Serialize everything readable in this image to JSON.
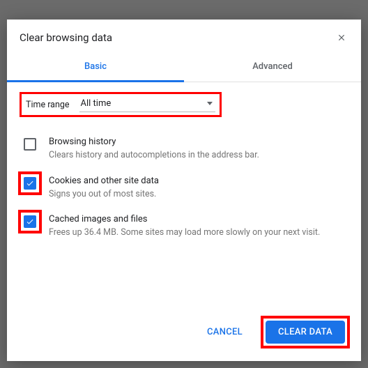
{
  "dialog": {
    "title": "Clear browsing data",
    "tabs": {
      "basic": "Basic",
      "advanced": "Advanced"
    },
    "timeRange": {
      "label": "Time range",
      "value": "All time"
    },
    "options": [
      {
        "title": "Browsing history",
        "desc": "Clears history and autocompletions in the address bar.",
        "checked": false,
        "highlighted": false
      },
      {
        "title": "Cookies and other site data",
        "desc": "Signs you out of most sites.",
        "checked": true,
        "highlighted": true
      },
      {
        "title": "Cached images and files",
        "desc": "Frees up 36.4 MB. Some sites may load more slowly on your next visit.",
        "checked": true,
        "highlighted": true
      }
    ],
    "buttons": {
      "cancel": "CANCEL",
      "clear": "CLEAR DATA"
    }
  }
}
